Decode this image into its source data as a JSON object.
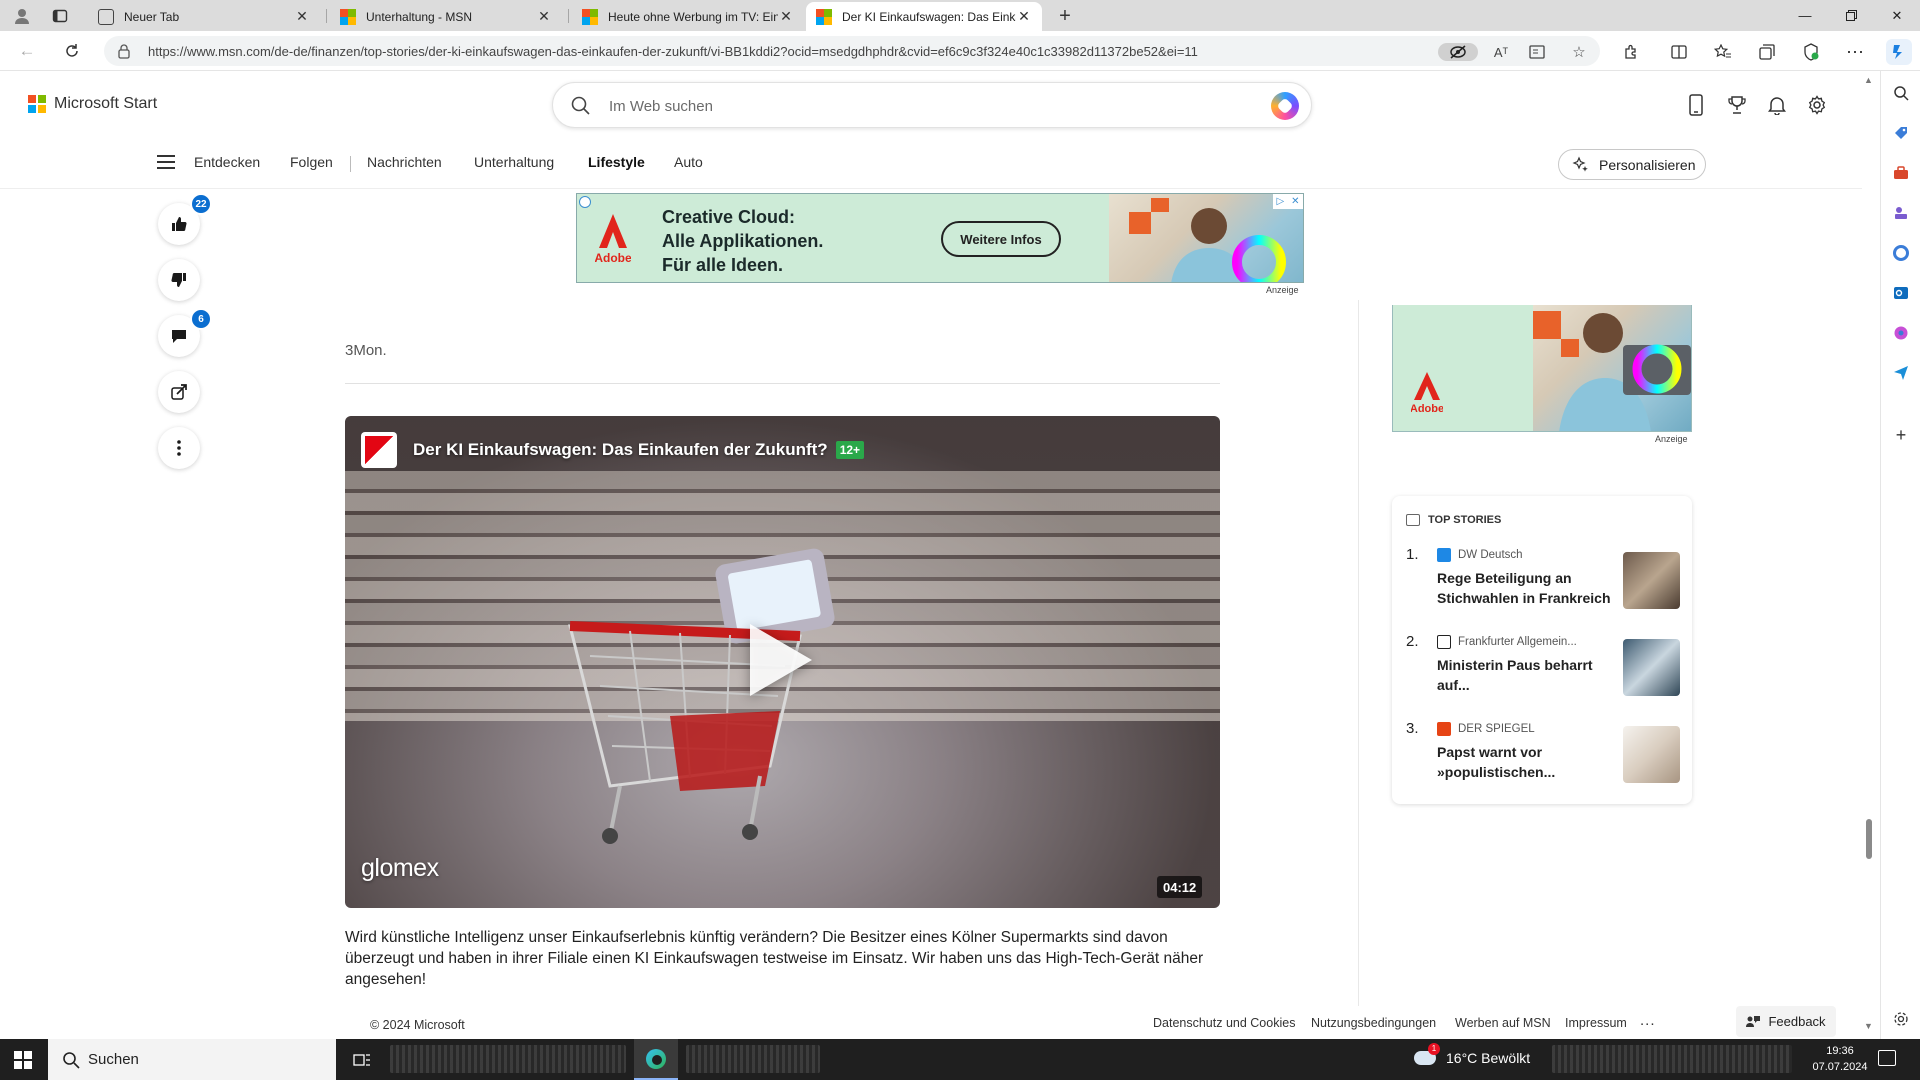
{
  "browser": {
    "tabs": [
      {
        "label": "Neuer Tab",
        "favicon": "newtab-icon"
      },
      {
        "label": "Unterhaltung - MSN",
        "favicon": "microsoft-icon"
      },
      {
        "label": "Heute ohne Werbung im TV: Ein",
        "favicon": "microsoft-icon"
      },
      {
        "label": "Der KI Einkaufswagen: Das Einka",
        "favicon": "microsoft-icon",
        "active": true
      }
    ],
    "url": "https://www.msn.com/de-de/finanzen/top-stories/der-ki-einkaufswagen-das-einkaufen-der-zukunft/vi-BB1kddi2?ocid=msedgdhphdr&cvid=ef6c9c3f324e40c1c33982d11372be52&ei=11",
    "read_aloud_label": "Aᵀ"
  },
  "header": {
    "brand": "Microsoft Start",
    "search_placeholder": "Im Web suchen",
    "nav": [
      "Entdecken",
      "Folgen",
      "Nachrichten",
      "Unterhaltung",
      "Lifestyle",
      "Auto"
    ],
    "personalize_label": "Personalisieren"
  },
  "actions": {
    "like_count": "22",
    "comment_count": "6"
  },
  "ad_top": {
    "brand": "Adobe",
    "line1": "Creative Cloud:",
    "line2": "Alle Applikationen.",
    "line3": "Für alle Ideen.",
    "cta": "Weitere Infos",
    "label": "Anzeige"
  },
  "article": {
    "meta": "3Mon.",
    "video": {
      "title": "Der KI Einkaufswagen: Das Einkaufen der Zukunft?",
      "age_rating": "12+",
      "brand": "glomex",
      "duration": "04:12"
    },
    "body": "Wird künstliche Intelligenz unser Einkaufserlebnis künftig verändern? Die Besitzer eines Kölner Supermarkts sind davon überzeugt und haben in ihrer Filiale einen KI Einkaufswagen testweise im Einsatz. Wir haben uns das High-Tech-Gerät näher angesehen!"
  },
  "ad_side": {
    "brand": "Adobe",
    "label": "Anzeige"
  },
  "top_stories": {
    "title": "TOP STORIES",
    "items": [
      {
        "num": "1.",
        "source": "DW Deutsch",
        "headline": "Rege Beteiligung an Stichwahlen in Frankreich",
        "source_color": "#1e88e5"
      },
      {
        "num": "2.",
        "source": "Frankfurter Allgemein...",
        "headline": "Ministerin Paus beharrt auf...",
        "source_color": "#222222"
      },
      {
        "num": "3.",
        "source": "DER SPIEGEL",
        "headline": "Papst warnt vor »populistischen...",
        "source_color": "#e64415"
      }
    ]
  },
  "footer": {
    "copyright": "© 2024 Microsoft",
    "links": [
      "Datenschutz und Cookies",
      "Nutzungsbedingungen",
      "Werben auf MSN",
      "Impressum"
    ],
    "more": "...",
    "feedback": "Feedback"
  },
  "taskbar": {
    "search_label": "Suchen",
    "weather": "16°C Bewölkt",
    "time": "19:36",
    "date": "07.07.2024"
  },
  "colors": {
    "accent": "#0b6ed0",
    "ad_background": "#cdebd7",
    "age_badge": "#2aa84a"
  }
}
